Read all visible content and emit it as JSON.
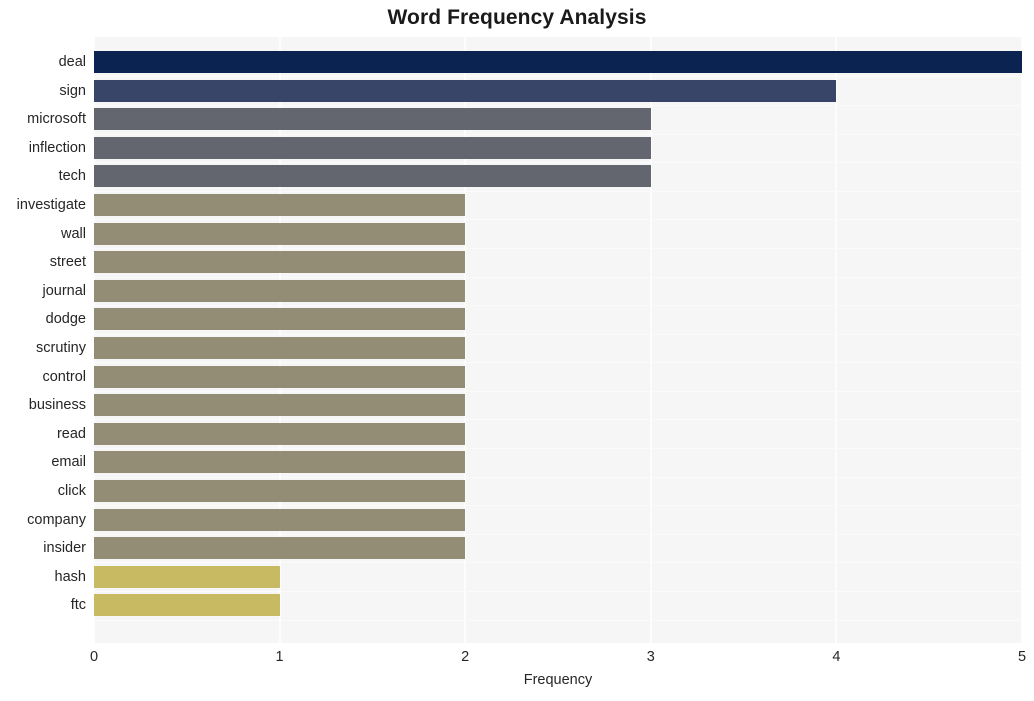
{
  "chart_data": {
    "type": "bar",
    "orientation": "horizontal",
    "title": "Word Frequency Analysis",
    "xlabel": "Frequency",
    "ylabel": "",
    "xlim": [
      0,
      5
    ],
    "ylim": null,
    "xticks": [
      0,
      1,
      2,
      3,
      4,
      5
    ],
    "xtick_labels": [
      "0",
      "1",
      "2",
      "3",
      "4",
      "5"
    ],
    "grid": true,
    "grid_axis": "both",
    "legend": null,
    "categories": [
      "deal",
      "sign",
      "microsoft",
      "inflection",
      "tech",
      "investigate",
      "wall",
      "street",
      "journal",
      "dodge",
      "scrutiny",
      "control",
      "business",
      "read",
      "email",
      "click",
      "company",
      "insider",
      "hash",
      "ftc"
    ],
    "values": [
      5,
      4,
      3,
      3,
      3,
      2,
      2,
      2,
      2,
      2,
      2,
      2,
      2,
      2,
      2,
      2,
      2,
      2,
      1,
      1
    ],
    "bar_colors": [
      "#0a2350",
      "#384468",
      "#63666e",
      "#63666e",
      "#63666e",
      "#938d76",
      "#938d76",
      "#938d76",
      "#938d76",
      "#938d76",
      "#938d76",
      "#938d76",
      "#938d76",
      "#938d76",
      "#938d76",
      "#938d76",
      "#938d76",
      "#938d76",
      "#c8b963",
      "#c8b963"
    ]
  },
  "style": {
    "plot_background": "#f6f6f7",
    "figure_background": "#ffffff",
    "gridline_color": "#fdfdfd",
    "title_color": "#1a1a1a",
    "tick_color": "#262626"
  }
}
